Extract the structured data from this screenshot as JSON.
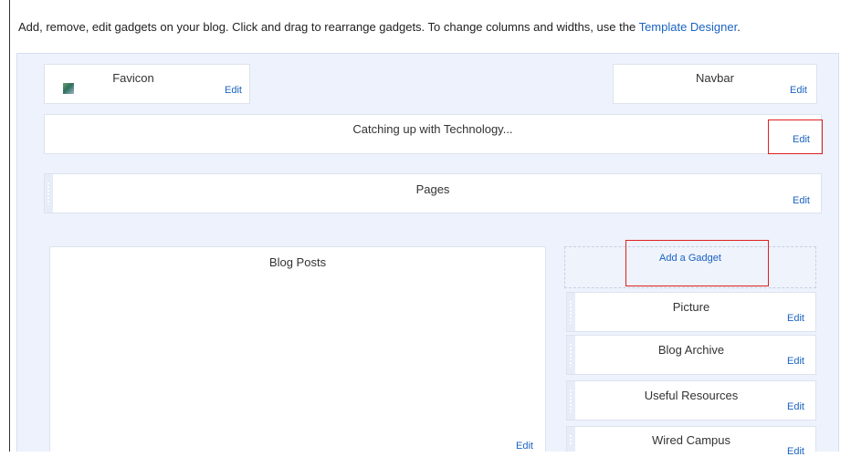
{
  "intro": {
    "text": "Add, remove, edit gadgets on your blog. Click and drag to rearrange gadgets. To change columns and widths, use the ",
    "link": "Template Designer",
    "end": "."
  },
  "colors": {
    "accent": "#1a63c2",
    "highlight": "#e02020",
    "canvas": "#edf2fc"
  },
  "gadgets": {
    "favicon": {
      "title": "Favicon",
      "edit": "Edit"
    },
    "navbar": {
      "title": "Navbar",
      "edit": "Edit"
    },
    "header": {
      "title": "Catching up with Technology...",
      "edit": "Edit"
    },
    "pages": {
      "title": "Pages",
      "edit": "Edit"
    },
    "blog_posts": {
      "title": "Blog Posts",
      "edit": "Edit"
    },
    "add_gadget": "Add a Gadget",
    "sidebar": [
      {
        "title": "Picture",
        "edit": "Edit"
      },
      {
        "title": "Blog Archive",
        "edit": "Edit"
      },
      {
        "title": "Useful Resources",
        "edit": "Edit"
      },
      {
        "title": "Wired Campus",
        "edit": "Edit"
      }
    ]
  }
}
